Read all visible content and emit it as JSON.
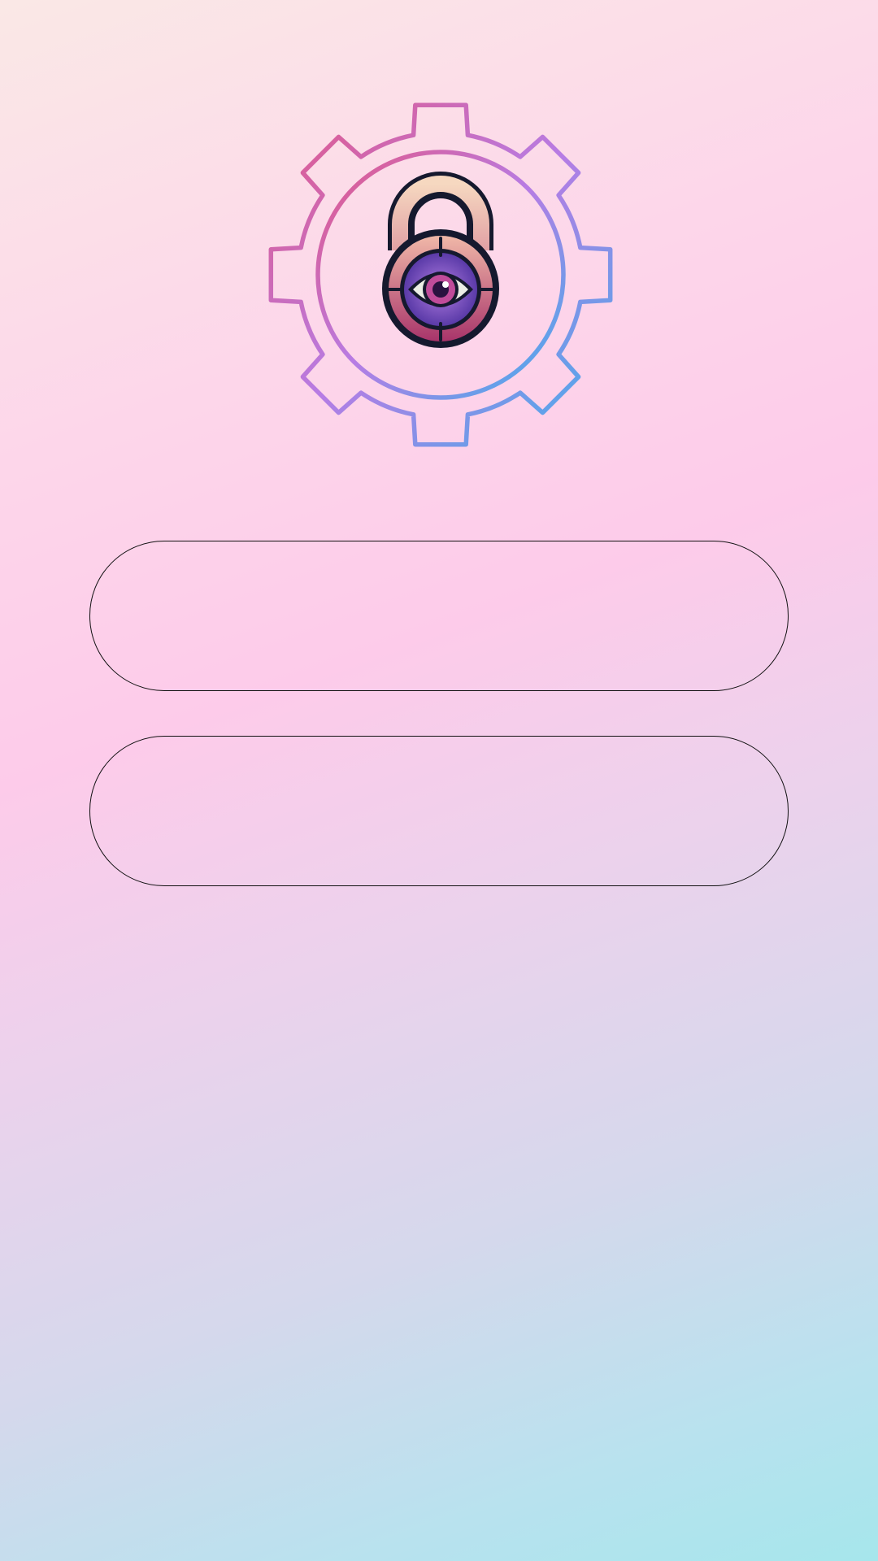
{
  "app": {
    "logo_icon": "gear-padlock-eye-icon",
    "colors": {
      "gear_gradient_start": "#e45684",
      "gear_gradient_mid": "#b77ce4",
      "gear_gradient_end": "#3fb0ec",
      "padlock_outline": "#15192e",
      "padlock_shackle": "#f2c3b0",
      "padlock_body_outer": "#c45378",
      "padlock_body_inner": "#7a4dc4",
      "eye_white": "#eceee6",
      "iris": "#c04c9a",
      "pupil": "#2a1240",
      "button_border": "#111111"
    }
  },
  "buttons": [
    {
      "label": ""
    },
    {
      "label": ""
    }
  ]
}
